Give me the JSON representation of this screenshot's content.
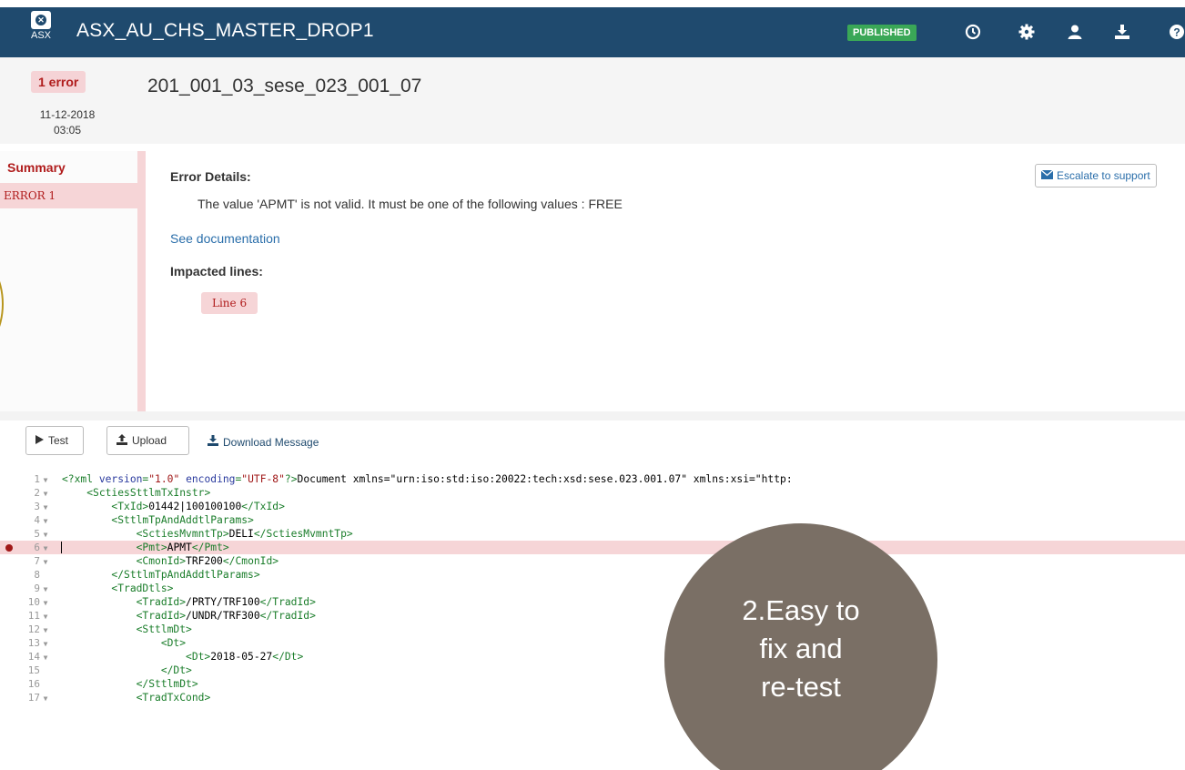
{
  "header": {
    "logo_text": "ASX",
    "app_title": "ASX_AU_CHS_MASTER_DROP1",
    "status_badge": "PUBLISHED",
    "icons": [
      "history-icon",
      "gear-icon",
      "user-icon",
      "download-icon",
      "help-icon"
    ],
    "colors": {
      "bg": "#1f4a6e",
      "badge": "#3aa757"
    }
  },
  "message": {
    "error_count": "1 error",
    "date": "11-12-2018",
    "time": "03:05",
    "title": "201_001_03_sese_023_001_07"
  },
  "sidebar": {
    "summary_label": "Summary",
    "items": [
      {
        "label": "ERROR 1"
      }
    ]
  },
  "details": {
    "heading": "Error Details:",
    "description": "The value 'APMT' is not valid. It must be one of the following values : FREE",
    "doc_link": "See documentation",
    "impacted_heading": "Impacted lines:",
    "impacted_line": "Line 6",
    "escalate_label": "Escalate to support"
  },
  "toolbar": {
    "test_label": "Test",
    "upload_label": "Upload",
    "download_label": "Download Message"
  },
  "editor": {
    "lines": [
      {
        "n": "1",
        "fold": true,
        "text": "<?xml version=\"1.0\" encoding=\"UTF-8\"?><Document xmlns=\"urn:iso:std:iso:20022:tech:xsd:sese.023.001.07\" xmlns:xsi=\"http:"
      },
      {
        "n": "2",
        "fold": true,
        "text": "    <SctiesSttlmTxInstr>"
      },
      {
        "n": "3",
        "fold": true,
        "text": "        <TxId>01442|100100100</TxId>"
      },
      {
        "n": "4",
        "fold": true,
        "text": "        <SttlmTpAndAddtlParams>"
      },
      {
        "n": "5",
        "fold": true,
        "text": "            <SctiesMvmntTp>DELI</SctiesMvmntTp>"
      },
      {
        "n": "6",
        "fold": true,
        "text": "            <Pmt>APMT</Pmt>",
        "error": true
      },
      {
        "n": "7",
        "fold": true,
        "text": "            <CmonId>TRF200</CmonId>"
      },
      {
        "n": "8",
        "fold": false,
        "text": "        </SttlmTpAndAddtlParams>"
      },
      {
        "n": "9",
        "fold": true,
        "text": "        <TradDtls>"
      },
      {
        "n": "10",
        "fold": true,
        "text": "            <TradId>/PRTY/TRF100</TradId>"
      },
      {
        "n": "11",
        "fold": true,
        "text": "            <TradId>/UNDR/TRF300</TradId>"
      },
      {
        "n": "12",
        "fold": true,
        "text": "            <SttlmDt>"
      },
      {
        "n": "13",
        "fold": true,
        "text": "                <Dt>"
      },
      {
        "n": "14",
        "fold": true,
        "text": "                    <Dt>2018-05-27</Dt>"
      },
      {
        "n": "15",
        "fold": false,
        "text": "                </Dt>"
      },
      {
        "n": "16",
        "fold": false,
        "text": "            </SttlmDt>"
      },
      {
        "n": "17",
        "fold": true,
        "text": "            <TradTxCond>"
      }
    ]
  },
  "overlay": {
    "lines": [
      "2.Easy to",
      "fix and",
      "re-test"
    ]
  }
}
